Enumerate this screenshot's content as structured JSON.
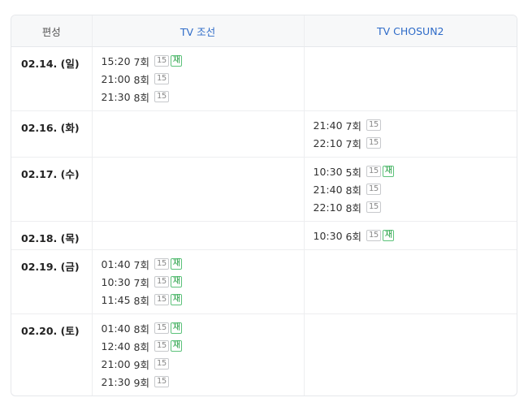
{
  "header": {
    "date_col": "편성",
    "channels": [
      "TV 조선",
      "TV CHOSUN2"
    ]
  },
  "rows": [
    {
      "date": "02.14. (일)",
      "channels": [
        [
          {
            "time": "15:20",
            "episode": "7회",
            "rating": "15",
            "rerun": "재"
          },
          {
            "time": "21:00",
            "episode": "8회",
            "rating": "15"
          },
          {
            "time": "21:30",
            "episode": "8회",
            "rating": "15"
          }
        ],
        []
      ]
    },
    {
      "date": "02.16. (화)",
      "channels": [
        [],
        [
          {
            "time": "21:40",
            "episode": "7회",
            "rating": "15"
          },
          {
            "time": "22:10",
            "episode": "7회",
            "rating": "15"
          }
        ]
      ]
    },
    {
      "date": "02.17. (수)",
      "channels": [
        [],
        [
          {
            "time": "10:30",
            "episode": "5회",
            "rating": "15",
            "rerun": "재"
          },
          {
            "time": "21:40",
            "episode": "8회",
            "rating": "15"
          },
          {
            "time": "22:10",
            "episode": "8회",
            "rating": "15"
          }
        ]
      ]
    },
    {
      "date": "02.18. (목)",
      "channels": [
        [],
        [
          {
            "time": "10:30",
            "episode": "6회",
            "rating": "15",
            "rerun": "재"
          }
        ]
      ]
    },
    {
      "date": "02.19. (금)",
      "channels": [
        [
          {
            "time": "01:40",
            "episode": "7회",
            "rating": "15",
            "rerun": "재"
          },
          {
            "time": "10:30",
            "episode": "7회",
            "rating": "15",
            "rerun": "재"
          },
          {
            "time": "11:45",
            "episode": "8회",
            "rating": "15",
            "rerun": "재"
          }
        ],
        []
      ]
    },
    {
      "date": "02.20. (토)",
      "channels": [
        [
          {
            "time": "01:40",
            "episode": "8회",
            "rating": "15",
            "rerun": "재"
          },
          {
            "time": "12:40",
            "episode": "8회",
            "rating": "15",
            "rerun": "재"
          },
          {
            "time": "21:00",
            "episode": "9회",
            "rating": "15"
          },
          {
            "time": "21:30",
            "episode": "9회",
            "rating": "15"
          }
        ],
        []
      ]
    }
  ]
}
